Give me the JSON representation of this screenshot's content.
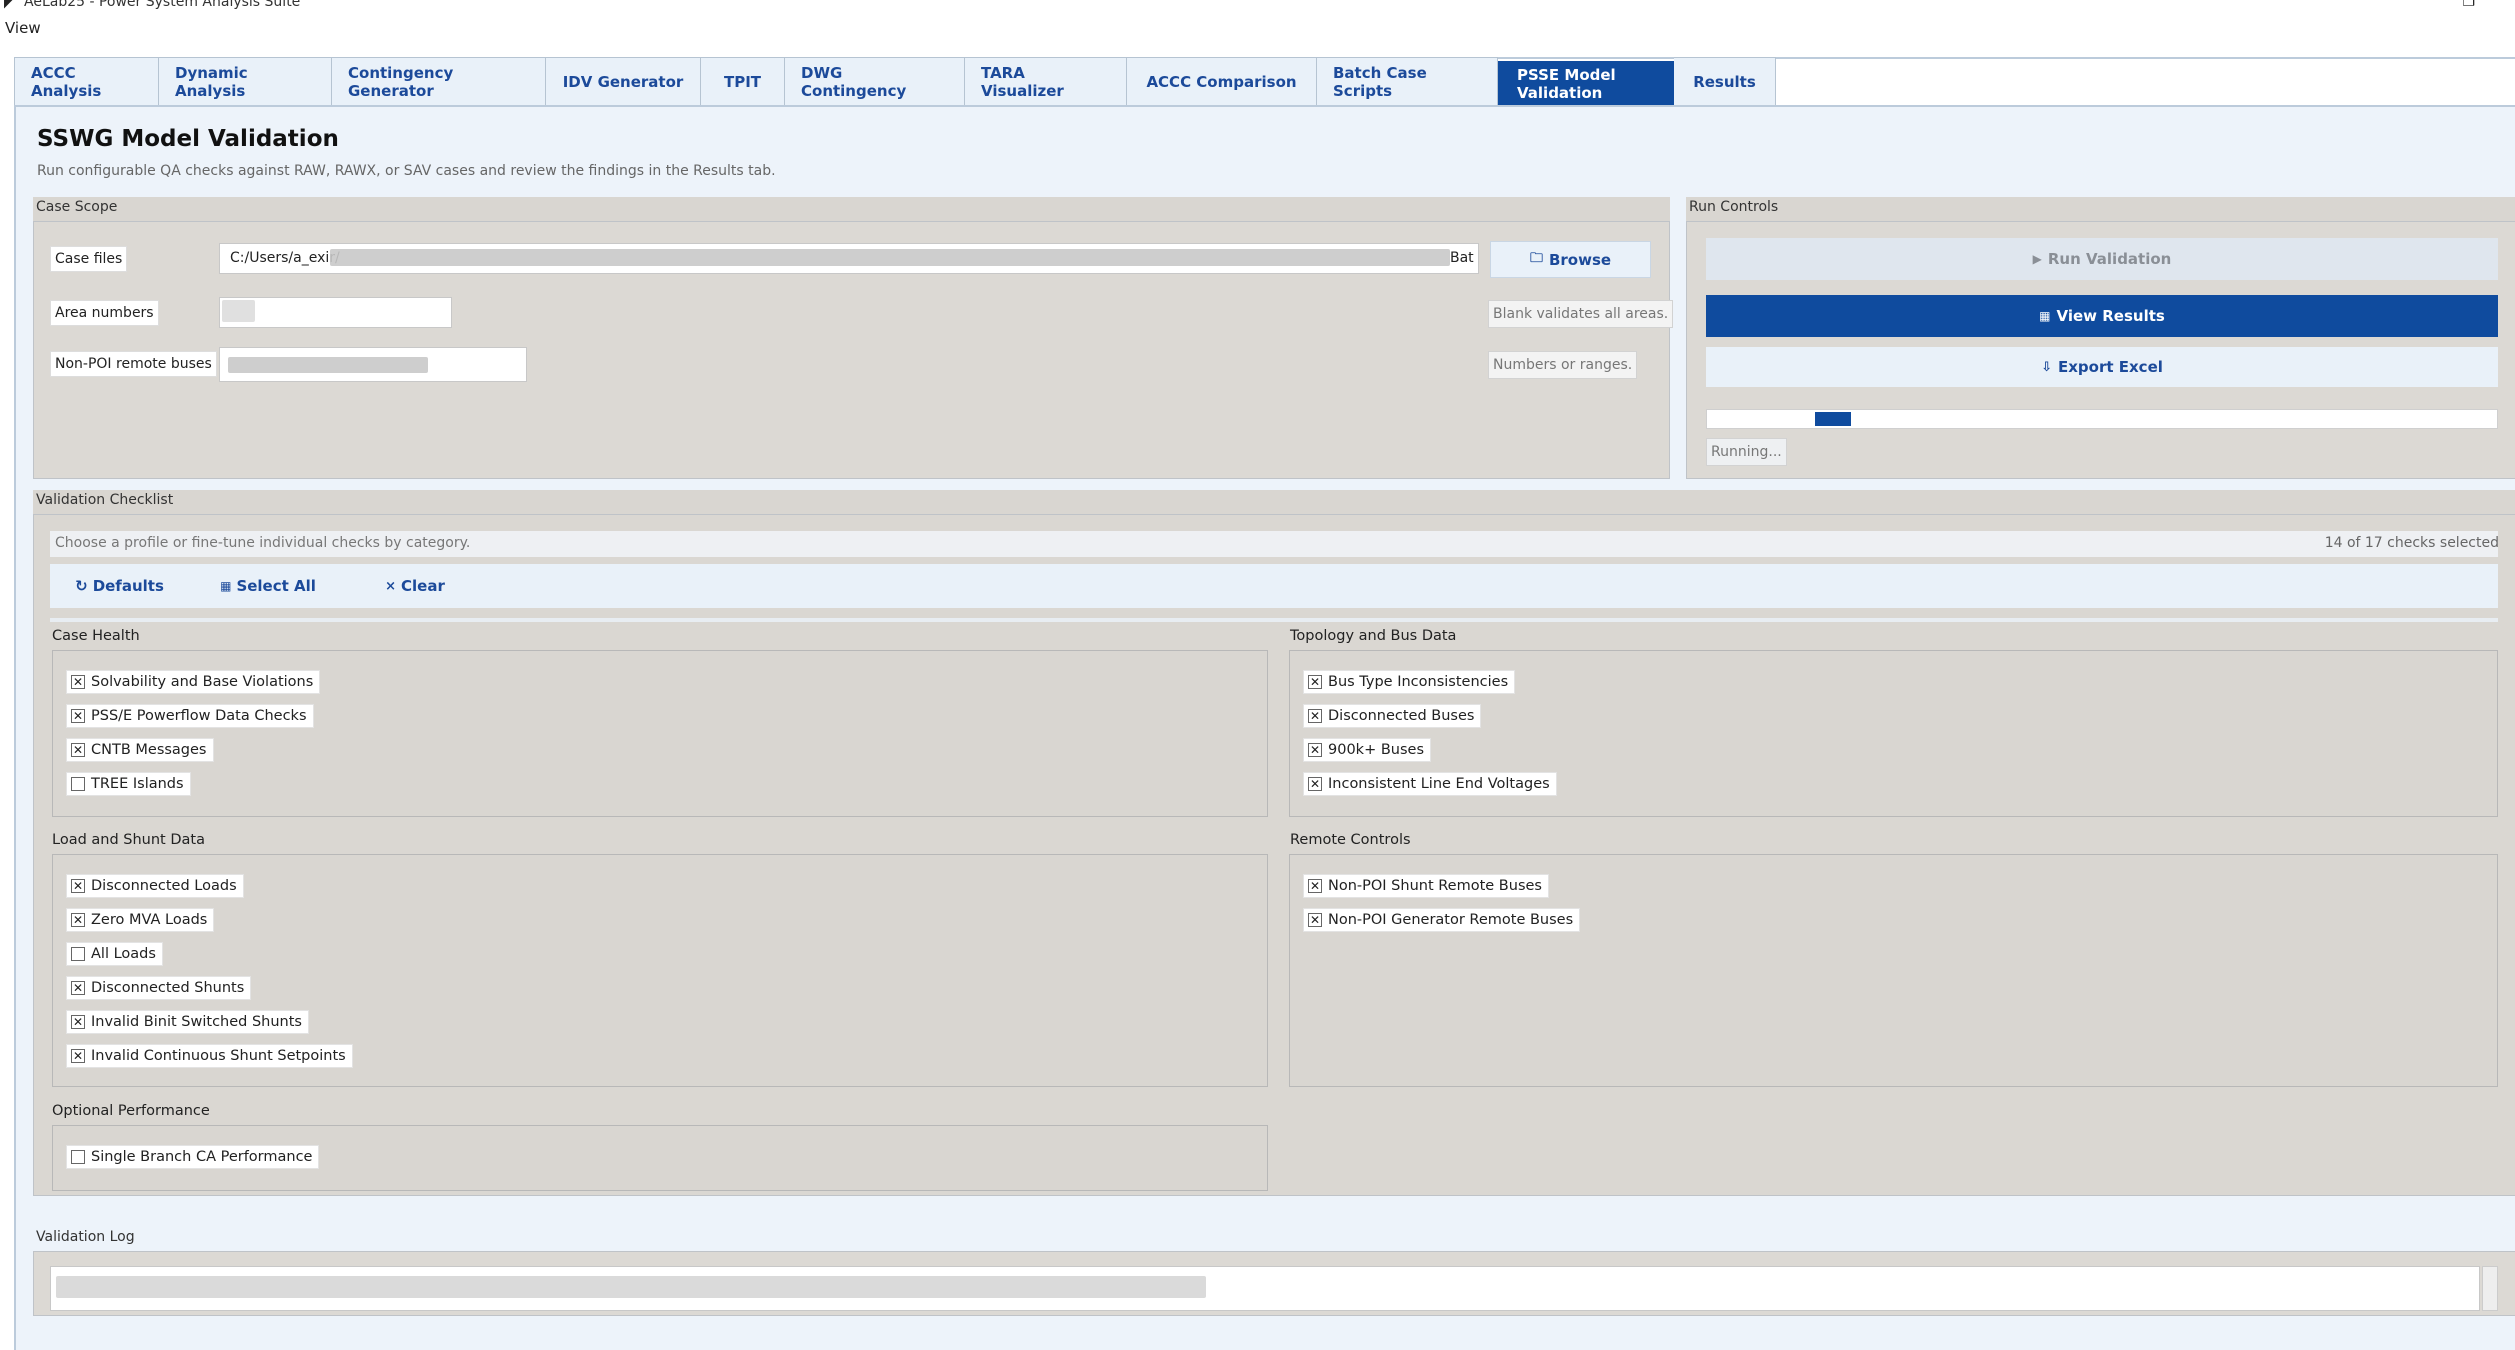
{
  "window": {
    "title": "AeLab25 - Power System Analysis Suite"
  },
  "menu": {
    "view": "View"
  },
  "tabs": [
    {
      "label": "ACCC Analysis"
    },
    {
      "label": "Dynamic Analysis"
    },
    {
      "label": "Contingency Generator"
    },
    {
      "label": "IDV Generator"
    },
    {
      "label": "TPIT"
    },
    {
      "label": "DWG Contingency"
    },
    {
      "label": "TARA Visualizer"
    },
    {
      "label": "ACCC Comparison"
    },
    {
      "label": "Batch Case Scripts"
    },
    {
      "label": "PSSE Model Validation",
      "active": true
    },
    {
      "label": "Results"
    }
  ],
  "header": {
    "title": "SSWG Model Validation",
    "subtitle": "Run configurable QA checks against RAW, RAWX, or SAV cases and review the findings in the Results tab."
  },
  "case_scope": {
    "title": "Case Scope",
    "case_files_label": "Case files",
    "case_files_value": "C:/Users/a_exir/",
    "case_files_tail": "Bat",
    "browse_label": "Browse",
    "area_label": "Area numbers",
    "area_hint": "Blank validates all areas.",
    "nonpoi_label": "Non-POI remote buses",
    "nonpoi_hint": "Numbers or ranges."
  },
  "run_controls": {
    "title": "Run Controls",
    "run_label": "Run Validation",
    "view_label": "View Results",
    "export_label": "Export Excel",
    "status": "Running...",
    "accent": "#0f4b9e"
  },
  "checklist": {
    "title": "Validation Checklist",
    "instructions": "Choose a profile or fine-tune individual checks by category.",
    "count": "14 of 17 checks selected",
    "defaults_label": "Defaults",
    "select_all_label": "Select All",
    "clear_label": "Clear",
    "groups": {
      "case_health": {
        "title": "Case Health",
        "items": [
          {
            "label": "Solvability and Base Violations",
            "checked": true
          },
          {
            "label": "PSS/E Powerflow Data Checks",
            "checked": true
          },
          {
            "label": "CNTB Messages",
            "checked": true
          },
          {
            "label": "TREE Islands",
            "checked": false
          }
        ]
      },
      "topology": {
        "title": "Topology and Bus Data",
        "items": [
          {
            "label": "Bus Type Inconsistencies",
            "checked": true
          },
          {
            "label": "Disconnected Buses",
            "checked": true
          },
          {
            "label": "900k+ Buses",
            "checked": true
          },
          {
            "label": "Inconsistent Line End Voltages",
            "checked": true
          }
        ]
      },
      "load_shunt": {
        "title": "Load and Shunt Data",
        "items": [
          {
            "label": "Disconnected Loads",
            "checked": true
          },
          {
            "label": "Zero MVA Loads",
            "checked": true
          },
          {
            "label": "All Loads",
            "checked": false
          },
          {
            "label": "Disconnected Shunts",
            "checked": true
          },
          {
            "label": "Invalid Binit Switched Shunts",
            "checked": true
          },
          {
            "label": "Invalid Continuous Shunt Setpoints",
            "checked": true
          }
        ]
      },
      "remote": {
        "title": "Remote Controls",
        "items": [
          {
            "label": "Non-POI Shunt Remote Buses",
            "checked": true
          },
          {
            "label": "Non-POI Generator Remote Buses",
            "checked": true
          }
        ]
      },
      "optional": {
        "title": "Optional Performance",
        "items": [
          {
            "label": "Single Branch CA Performance",
            "checked": false
          }
        ]
      }
    }
  },
  "log": {
    "title": "Validation Log"
  },
  "icons": {
    "run": "play-icon",
    "view": "table-icon",
    "export": "download-icon",
    "browse": "folder-icon",
    "defaults": "refresh-icon",
    "select_all": "grid-icon",
    "clear": "x-icon"
  }
}
